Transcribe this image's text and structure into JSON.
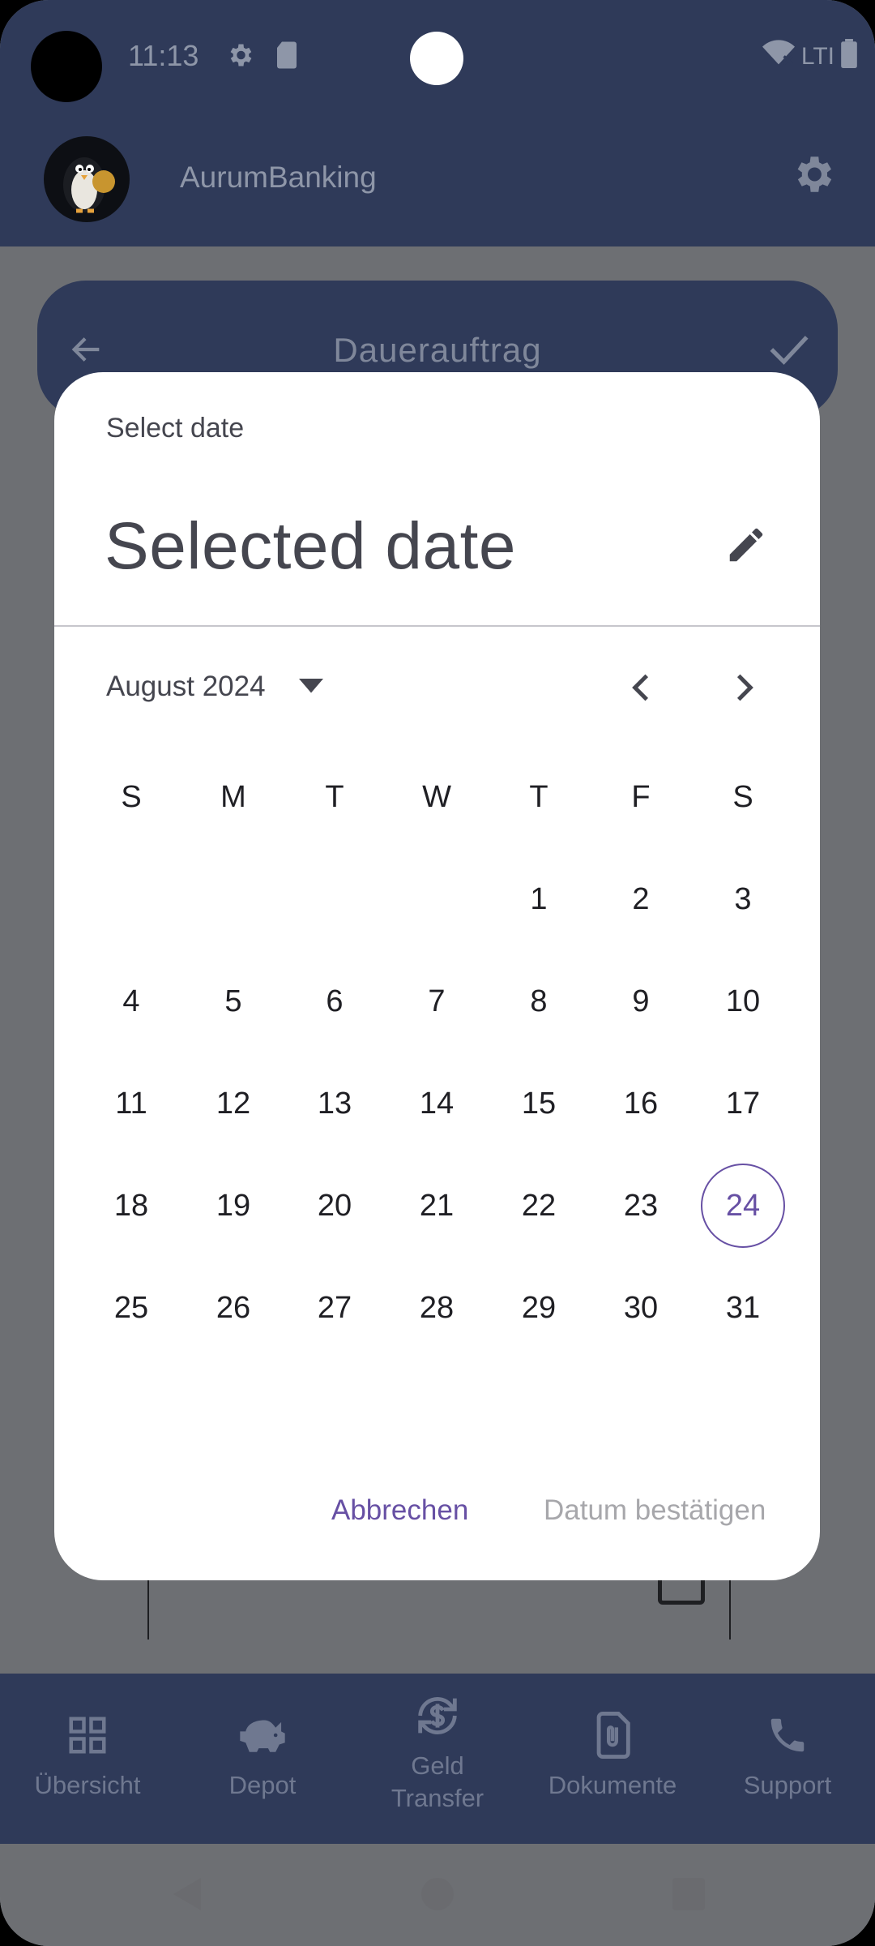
{
  "status_bar": {
    "time": "11:13",
    "network_label": "LTI"
  },
  "app_bar": {
    "title": "AurumBanking"
  },
  "card": {
    "title": "Dauerauftrag"
  },
  "bottom_nav": {
    "items": [
      {
        "label": "Übersicht"
      },
      {
        "label": "Depot"
      },
      {
        "label": "Geld\nTransfer"
      },
      {
        "label": "Dokumente"
      },
      {
        "label": "Support"
      }
    ]
  },
  "dialog": {
    "heading": "Select date",
    "selected_text": "Selected date",
    "month_label": "August 2024",
    "weekdays": [
      "S",
      "M",
      "T",
      "W",
      "T",
      "F",
      "S"
    ],
    "days": [
      "1",
      "2",
      "3",
      "4",
      "5",
      "6",
      "7",
      "8",
      "9",
      "10",
      "11",
      "12",
      "13",
      "14",
      "15",
      "16",
      "17",
      "18",
      "19",
      "20",
      "21",
      "22",
      "23",
      "24",
      "25",
      "26",
      "27",
      "28",
      "29",
      "30",
      "31"
    ],
    "first_weekday_index": 4,
    "selected_day": "24",
    "cancel_label": "Abbrechen",
    "confirm_label": "Datum bestätigen"
  },
  "colors": {
    "primary": "#6750a4",
    "app_bar": "#2f3a59",
    "scrim_page": "#6d6f73",
    "disabled_text": "#a7a7ab"
  }
}
